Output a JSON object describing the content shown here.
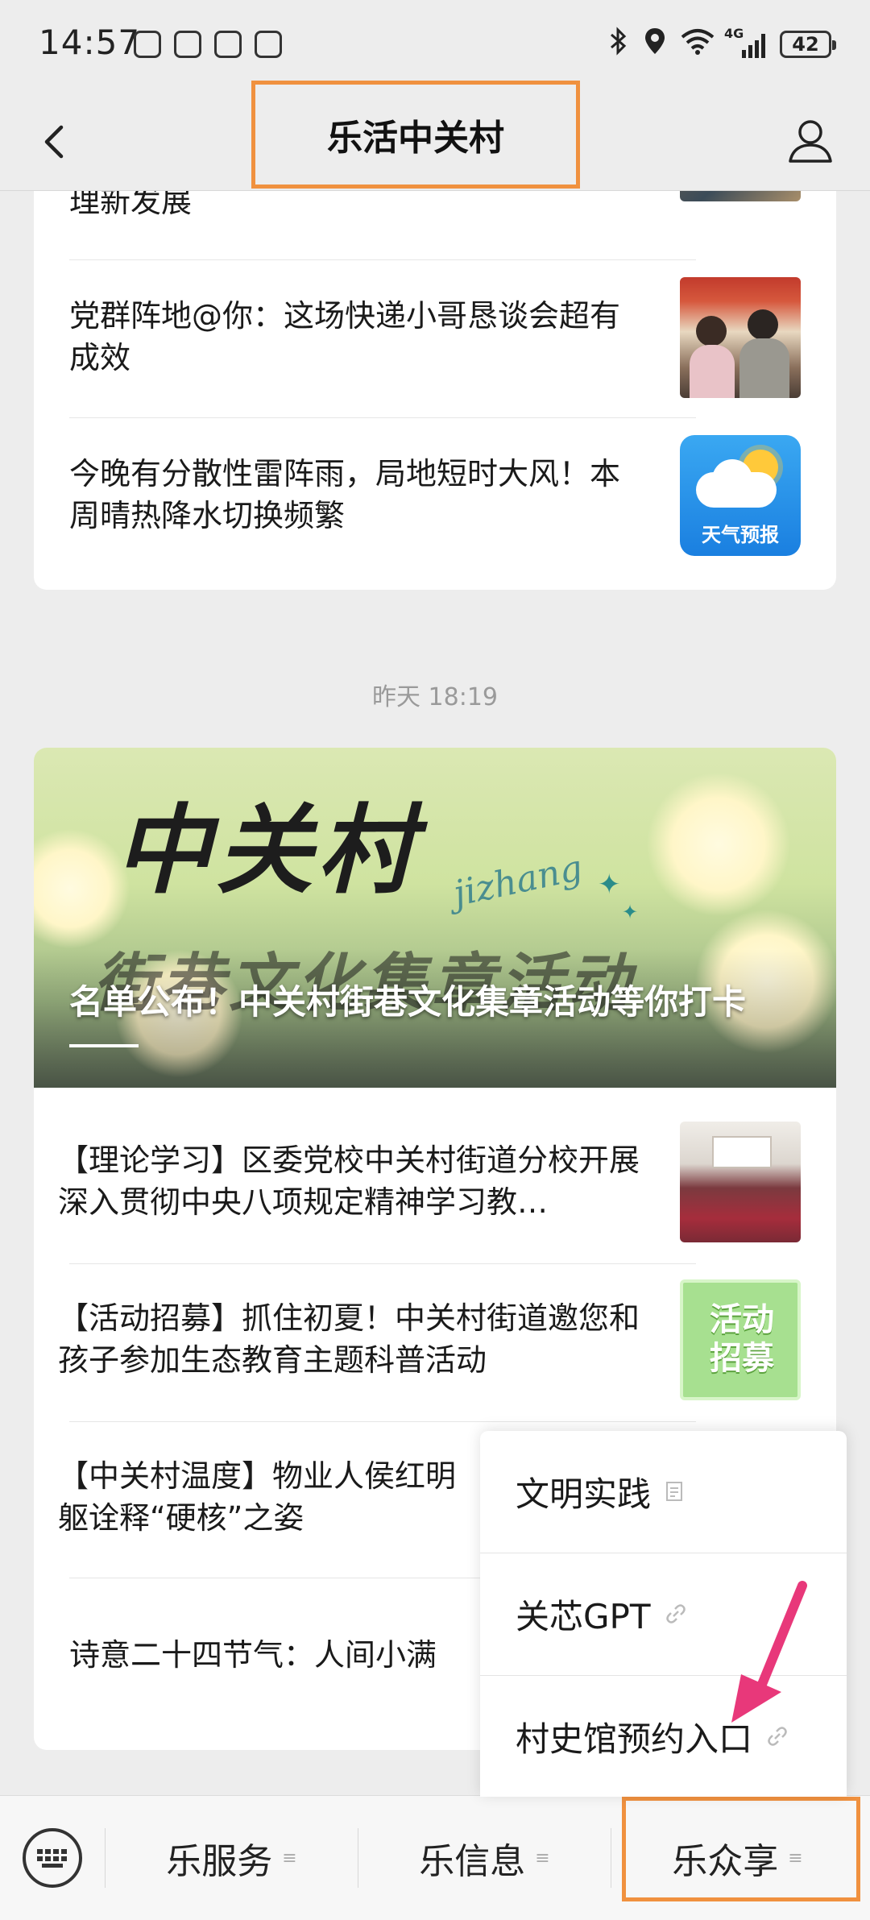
{
  "status_bar": {
    "time": "14:57",
    "battery": "42",
    "network": "4G"
  },
  "nav": {
    "title": "乐活中关村",
    "back_icon": "back-chevron-icon",
    "profile_icon": "profile-icon"
  },
  "card1": {
    "articles": [
      {
        "title": "理新发展"
      },
      {
        "title": "党群阵地@你：这场快递小哥恳谈会超有成效"
      },
      {
        "title": "今晚有分散性雷阵雨，局地短时大风！本周晴热降水切换频繁",
        "thumb_label": "天气预报"
      }
    ]
  },
  "timestamp": "昨天 18:19",
  "card2": {
    "hero": {
      "big_text": "中关村",
      "script_text": "jizhang",
      "sub_text": "街巷文化集章活动",
      "title": "名单公布！中关村街巷文化集章活动等你打卡"
    },
    "articles": [
      {
        "title": "【理论学习】区委党校中关村街道分校开展深入贯彻中央八项规定精神学习教…"
      },
      {
        "title": "【活动招募】抓住初夏！中关村街道邀您和孩子参加生态教育主题科普活动",
        "thumb_label": "活动招募"
      },
      {
        "title": "【中关村温度】物业人侯红明躯诠释“硬核”之姿"
      },
      {
        "title": "诗意二十四节气：人间小满"
      }
    ]
  },
  "popup_menu": {
    "items": [
      {
        "label": "文明实践",
        "icon": "document-icon"
      },
      {
        "label": "关芯GPT",
        "icon": "link-icon"
      },
      {
        "label": "村史馆预约入口",
        "icon": "link-icon"
      }
    ]
  },
  "bottom_menu": {
    "keyboard_icon": "keyboard-icon",
    "tabs": [
      {
        "label": "乐服务"
      },
      {
        "label": "乐信息"
      },
      {
        "label": "乐众享"
      }
    ]
  },
  "colors": {
    "highlight": "#f0913f",
    "arrow": "#e8387a"
  }
}
